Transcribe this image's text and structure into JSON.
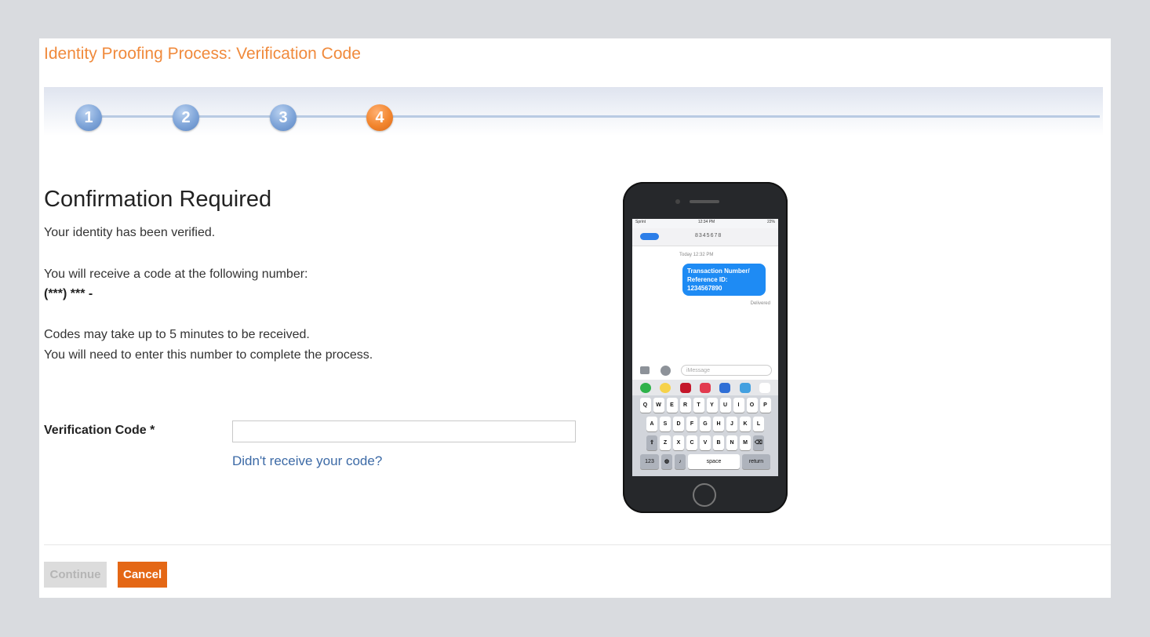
{
  "page": {
    "title": "Identity Proofing Process: Verification Code"
  },
  "stepper": {
    "steps": [
      "1",
      "2",
      "3",
      "4"
    ],
    "current_step": 4
  },
  "content": {
    "heading": "Confirmation Required",
    "verified_text": "Your identity has been verified.",
    "receive_text": "You will receive a code at the following number:",
    "masked_number": "(***) *** -",
    "delay_text": "Codes may take up to 5 minutes to be received.",
    "enter_text": "You will need to enter this number to complete the process."
  },
  "form": {
    "code_label": "Verification Code *",
    "code_value": "",
    "resend_link": "Didn't receive your code?"
  },
  "buttons": {
    "continue_label": "Continue",
    "cancel_label": "Cancel"
  },
  "phone": {
    "carrier": "Sprint",
    "time": "12:34 PM",
    "battery": "22%",
    "contact": "8345678",
    "date_label": "Today 12:32 PM",
    "message": "Transaction Number/ Reference ID: 1234567890",
    "delivered_label": "Delivered",
    "message_placeholder": "iMessage",
    "keyboard_rows": [
      [
        "Q",
        "W",
        "E",
        "R",
        "T",
        "Y",
        "U",
        "I",
        "O",
        "P"
      ],
      [
        "A",
        "S",
        "D",
        "F",
        "G",
        "H",
        "J",
        "K",
        "L"
      ],
      [
        "Z",
        "X",
        "C",
        "V",
        "B",
        "N",
        "M"
      ]
    ],
    "key_123": "123",
    "key_space": "space",
    "key_return": "return"
  },
  "colors": {
    "title": "#f08a3c",
    "step_inactive": "#7ea4d8",
    "step_active": "#f2852e",
    "link": "#3c6aa6",
    "cancel_bg": "#e46715",
    "continue_disabled_bg": "#dcdcdc"
  }
}
